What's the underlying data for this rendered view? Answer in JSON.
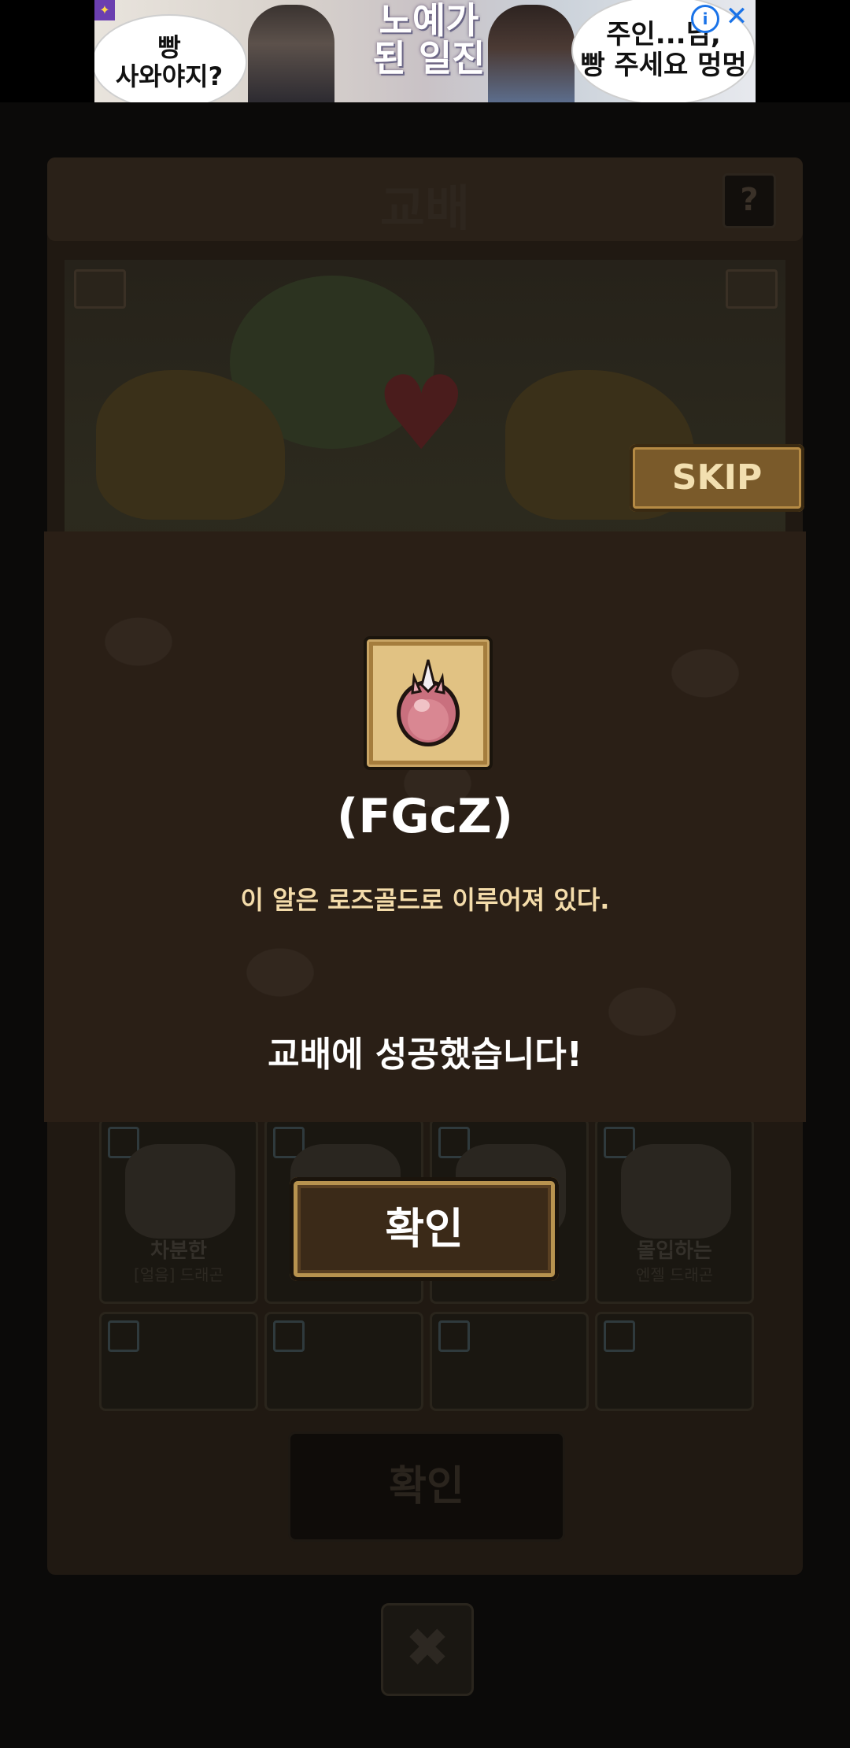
{
  "ad": {
    "left_bubble": "빵\n사와야지?",
    "headline": "노예가\n된 일진",
    "right_bubble": "주인...님,\n빵 주세요 멍멍",
    "info_icon": "info-icon",
    "close_icon": "close-icon"
  },
  "background": {
    "title": "교배",
    "help_label": "?",
    "cards": [
      {
        "name": "차분한",
        "sub": "[얼음] 드래곤"
      },
      {
        "name": "",
        "sub": ""
      },
      {
        "name": "",
        "sub": ""
      },
      {
        "name": "몰입하는",
        "sub": "엔젤 드래곤"
      }
    ],
    "confirm_label": "확인",
    "close_label": "✖"
  },
  "skip_label": "SKIP",
  "modal": {
    "item_icon": "egg-icon",
    "item_name": "(FGcZ)",
    "item_description": "이 알은 로즈골드로 이루어져 있다.",
    "result_message": "교배에 성공했습니다!",
    "confirm_label": "확인"
  },
  "colors": {
    "modal_bg": "#2a1f16",
    "description_text": "#f4dcaa",
    "frame_gold": "#e1c283",
    "egg_pink": "#c9707e"
  }
}
